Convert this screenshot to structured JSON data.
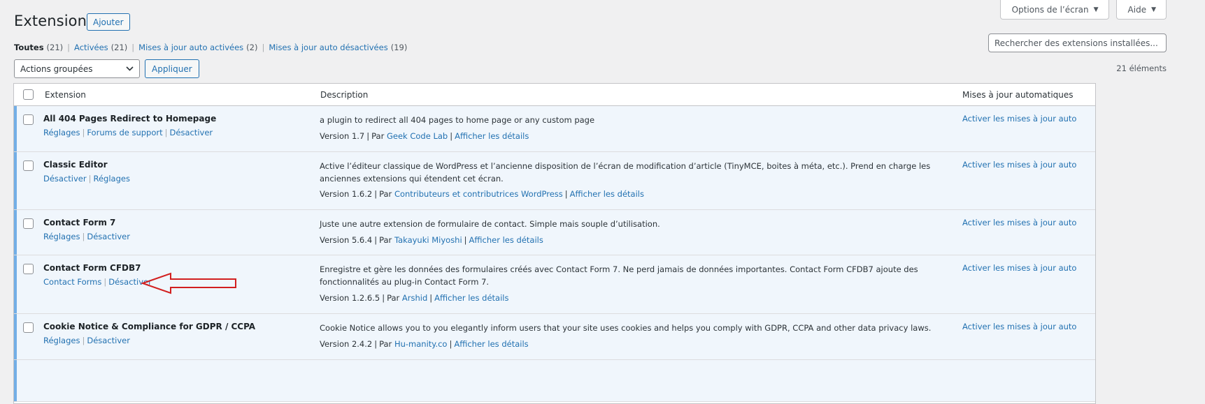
{
  "screen_meta": {
    "options_label": "Options de l’écran",
    "help_label": "Aide"
  },
  "header": {
    "title": "Extensions",
    "add_label": "Ajouter"
  },
  "filters": [
    {
      "label": "Toutes",
      "count": "(21)",
      "current": true
    },
    {
      "label": "Activées",
      "count": "(21)"
    },
    {
      "label": "Mises à jour auto activées",
      "count": "(2)"
    },
    {
      "label": "Mises à jour auto désactivées",
      "count": "(19)"
    }
  ],
  "search": {
    "placeholder": "Rechercher des extensions installées..."
  },
  "bulk": {
    "selected": "Actions groupées",
    "apply_label": "Appliquer",
    "item_count": "21 éléments"
  },
  "table": {
    "headers": {
      "extension": "Extension",
      "description": "Description",
      "auto": "Mises à jour automatiques"
    },
    "rows": [
      {
        "name": "All 404 Pages Redirect to Homepage",
        "actions": [
          "Réglages",
          "Forums de support",
          "Désactiver"
        ],
        "description": "a plugin to redirect all 404 pages to home page or any custom page",
        "version": "Version 1.7",
        "by": "Par",
        "author": "Geek Code Lab",
        "details": "Afficher les détails",
        "auto": "Activer les mises à jour auto"
      },
      {
        "name": "Classic Editor",
        "actions": [
          "Désactiver",
          "Réglages"
        ],
        "description": "Active l’éditeur classique de WordPress et l’ancienne disposition de l’écran de modification d’article (TinyMCE, boites à méta, etc.). Prend en charge les anciennes extensions qui étendent cet écran.",
        "version": "Version 1.6.2",
        "by": "Par",
        "author": "Contributeurs et contributrices WordPress",
        "details": "Afficher les détails",
        "auto": "Activer les mises à jour auto"
      },
      {
        "name": "Contact Form 7",
        "actions": [
          "Réglages",
          "Désactiver"
        ],
        "description": "Juste une autre extension de formulaire de contact. Simple mais souple d’utilisation.",
        "version": "Version 5.6.4",
        "by": "Par",
        "author": "Takayuki Miyoshi",
        "details": "Afficher les détails",
        "auto": "Activer les mises à jour auto"
      },
      {
        "name": "Contact Form CFDB7",
        "actions": [
          "Contact Forms",
          "Désactiver"
        ],
        "description": "Enregistre et gère les données des formulaires créés avec Contact Form 7. Ne perd jamais de données importantes. Contact Form CFDB7 ajoute des fonctionnalités au plug-in Contact Form 7.",
        "version": "Version 1.2.6.5",
        "by": "Par",
        "author": "Arshid",
        "details": "Afficher les détails",
        "auto": "Activer les mises à jour auto"
      },
      {
        "name": "Cookie Notice & Compliance for GDPR / CCPA",
        "actions": [
          "Réglages",
          "Désactiver"
        ],
        "description": "Cookie Notice allows you to you elegantly inform users that your site uses cookies and helps you comply with GDPR, CCPA and other data privacy laws.",
        "version": "Version 2.4.2",
        "by": "Par",
        "author": "Hu-manity.co",
        "details": "Afficher les détails",
        "auto": "Activer les mises à jour auto"
      }
    ]
  },
  "colors": {
    "link": "#2271b1",
    "active_row_bg": "#f0f6fc",
    "active_row_border": "#72aee6",
    "annotation_arrow": "#d21f1f"
  }
}
